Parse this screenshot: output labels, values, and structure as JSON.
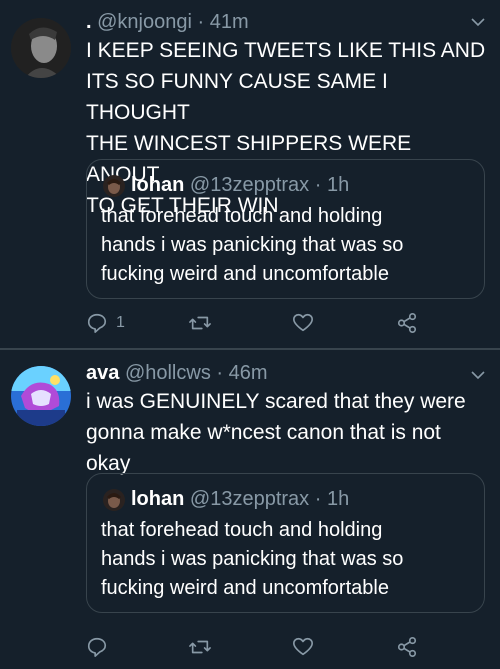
{
  "tweets": [
    {
      "name": ".",
      "handle": "@knjoongi",
      "sep": "·",
      "time": "41m",
      "text": "I KEEP SEEING TWEETS LIKE THIS AND\nITS SO FUNNY CAUSE SAME I THOUGHT\nTHE WINCEST SHIPPERS WERE ANOUT\nTO GET THEIR WIN",
      "quote": {
        "name": "lohan",
        "handle": "@13zepptrax",
        "sep": "·",
        "time": "1h",
        "text": "that forehead touch and holding\nhands i was panicking that was so\nfucking weird and uncomfortable"
      },
      "reply_count": "1"
    },
    {
      "name": "ava",
      "handle": "@hollcws",
      "sep": "·",
      "time": "46m",
      "text": "i was GENUINELY scared that they were\ngonna make w*ncest canon that is not\nokay",
      "quote": {
        "name": "lohan",
        "handle": "@13zepptrax",
        "sep": "·",
        "time": "1h",
        "text": "that forehead touch and holding\nhands i was panicking that was so\nfucking weird and uncomfortable"
      },
      "reply_count": ""
    }
  ],
  "colors": {
    "background": "#15202b",
    "border": "#38444d",
    "secondary_text": "#8899a6",
    "primary_text": "#ffffff"
  },
  "icons": [
    "reply-icon",
    "retweet-icon",
    "like-icon",
    "share-icon",
    "chevron-down-icon"
  ]
}
